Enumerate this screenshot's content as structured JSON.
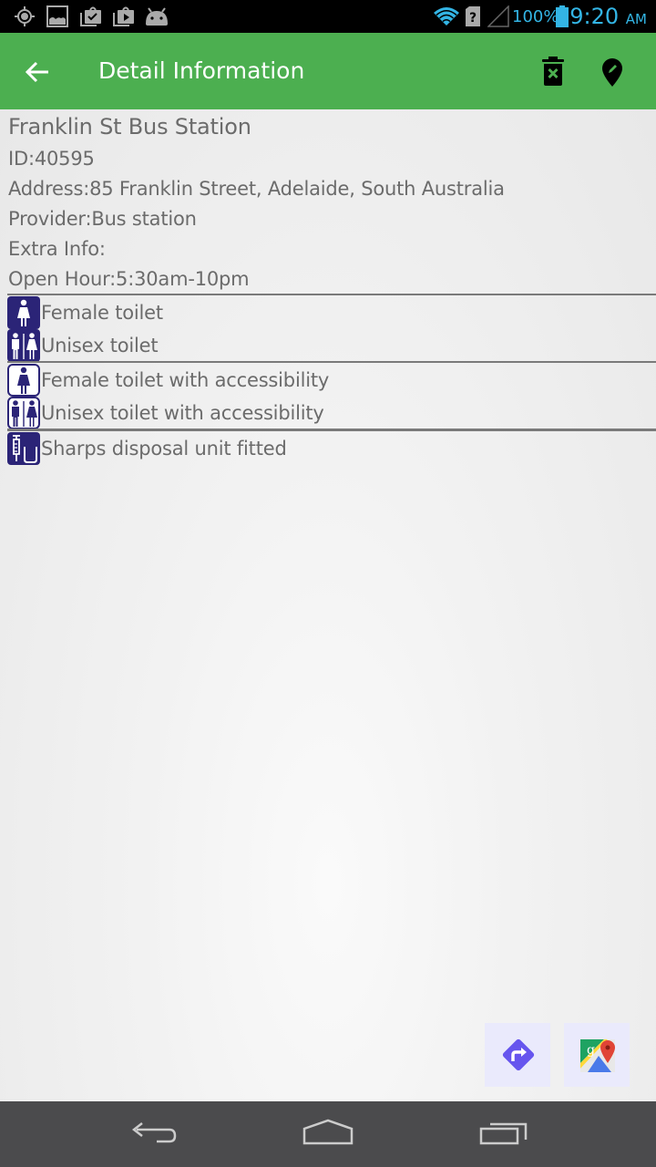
{
  "status_bar": {
    "left_icons": [
      "gps-icon",
      "gallery-icon",
      "store-update-icon",
      "play-store-icon",
      "android-icon"
    ],
    "right_icons": [
      "wifi-icon",
      "no-sim-icon",
      "cell-signal-icon",
      "battery-icon"
    ],
    "battery_percent": "100%",
    "time": "9:20",
    "ampm": "AM"
  },
  "app_bar": {
    "title": "Detail Information",
    "back_icon": "arrow-left-icon",
    "actions": [
      {
        "name": "delete-button",
        "icon": "trash-x-icon"
      },
      {
        "name": "edit-location-button",
        "icon": "map-pin-edit-icon"
      }
    ]
  },
  "detail": {
    "name": "Franklin St Bus Station",
    "id_line": "ID:40595",
    "address_line": "Address:85 Franklin Street, Adelaide, South Australia",
    "provider_line": "Provider:Bus station",
    "extra_info_line": "Extra Info:",
    "open_hour_line": "Open Hour:5:30am-10pm"
  },
  "facility_groups": [
    [
      {
        "label": "Female toilet",
        "icon": "female-toilet-icon"
      },
      {
        "label": "Unisex toilet",
        "icon": "unisex-toilet-icon"
      }
    ],
    [
      {
        "label": "Female toilet with accessibility",
        "icon": "female-accessible-toilet-icon"
      },
      {
        "label": "Unisex toilet with accessibility",
        "icon": "unisex-accessible-toilet-icon"
      }
    ],
    [
      {
        "label": "Sharps disposal unit fitted",
        "icon": "sharps-disposal-icon"
      }
    ]
  ],
  "fab_buttons": [
    {
      "name": "directions-button",
      "icon": "directions-icon"
    },
    {
      "name": "google-maps-button",
      "icon": "google-maps-icon"
    }
  ],
  "nav_bar": {
    "buttons": [
      "back-nav-icon",
      "home-nav-icon",
      "recents-nav-icon"
    ]
  },
  "colors": {
    "app_bar": "#4caf50",
    "status_accent": "#33b5e5",
    "icon_navy": "#2b2477",
    "directions_purple": "#6655ee",
    "text": "#6b6b6b",
    "nav_bar": "#4b4b4d"
  }
}
